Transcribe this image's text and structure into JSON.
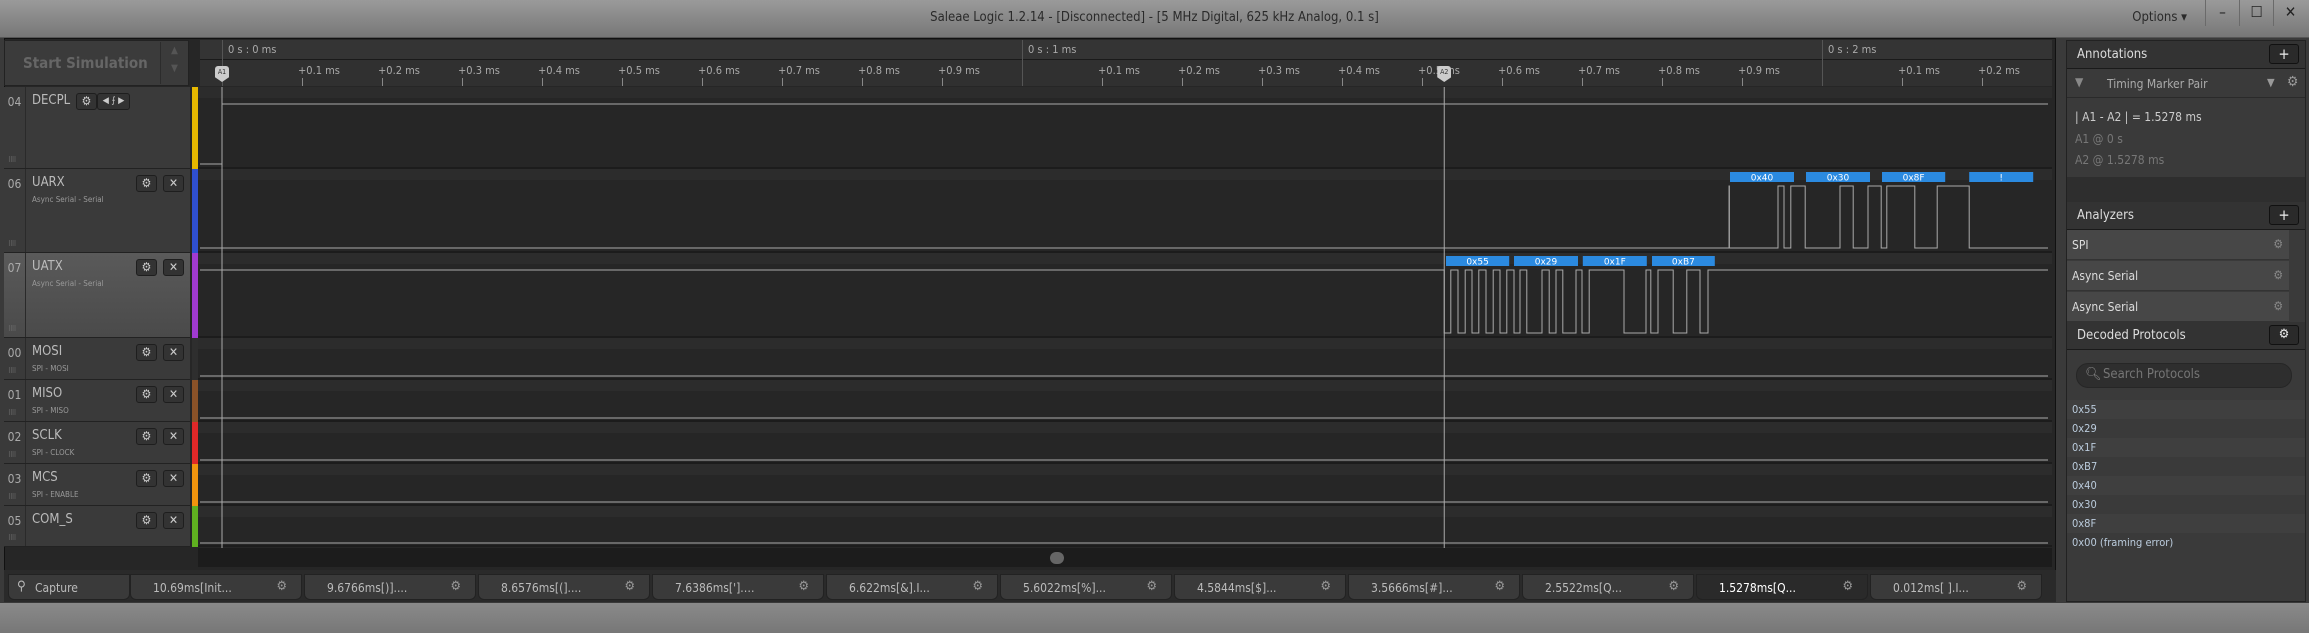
{
  "window": {
    "title": "Saleae Logic 1.2.14 - [Disconnected] - [5 MHz Digital, 625 kHz Analog, 0.1 s]",
    "options_label": "Options ▾",
    "minimize": "–",
    "maximize": "☐",
    "close": "✕"
  },
  "sim": {
    "label": "Start Simulation"
  },
  "timeline": {
    "major": [
      {
        "t": 0,
        "label": "0 s : 0 ms"
      },
      {
        "t": 1,
        "label": "0 s : 1 ms"
      },
      {
        "t": 2,
        "label": "0 s : 2 ms"
      }
    ],
    "minor_labels": [
      "+0.1 ms",
      "+0.2 ms",
      "+0.3 ms",
      "+0.4 ms",
      "+0.5 ms",
      "+0.6 ms",
      "+0.7 ms",
      "+0.8 ms",
      "+0.9 ms"
    ],
    "view_ms": [
      -0.0275,
      2.2825
    ],
    "markers": [
      {
        "label": "A1",
        "t": 0
      },
      {
        "label": "A2",
        "t": 1.5278
      }
    ]
  },
  "channels": [
    {
      "num": "04",
      "name": "DECPL",
      "sub": "",
      "color": "#e6b800",
      "init": 0,
      "toggles": [
        0
      ],
      "labels": []
    },
    {
      "num": "06",
      "name": "UARX",
      "sub": "Async Serial - Serial",
      "color": "#2f4fd0",
      "init": 0,
      "toggles": [
        1.8838,
        1.8842,
        1.945,
        1.9525,
        1.961,
        1.979,
        2.0225,
        2.039,
        2.0575,
        2.074,
        2.081,
        2.116,
        2.144,
        2.184
      ],
      "labels": [
        {
          "text": "0x40",
          "t0": 1.885,
          "t1": 1.965
        },
        {
          "text": "0x30",
          "t0": 1.98,
          "t1": 2.06
        },
        {
          "text": "0x8F",
          "t0": 2.075,
          "t1": 2.154
        },
        {
          "text": "!",
          "t0": 2.184,
          "t1": 2.264
        }
      ]
    },
    {
      "num": "07",
      "name": "UATX",
      "sub": "Async Serial - Serial",
      "color": "#a03ad0",
      "init": 1,
      "toggles": [
        1.5278,
        1.536,
        1.545,
        1.554,
        1.5625,
        1.571,
        1.58,
        1.589,
        1.5975,
        1.606,
        1.615,
        1.6225,
        1.631,
        1.65,
        1.659,
        1.6675,
        1.676,
        1.6925,
        1.7,
        1.709,
        1.7525,
        1.78,
        1.786,
        1.795,
        1.814,
        1.831,
        1.8475,
        1.8575
      ],
      "labels": [
        {
          "text": "0x55",
          "t0": 1.53,
          "t1": 1.609
        },
        {
          "text": "0x29",
          "t0": 1.615,
          "t1": 1.695
        },
        {
          "text": "0x1F",
          "t0": 1.701,
          "t1": 1.781
        },
        {
          "text": "0xB7",
          "t0": 1.7875,
          "t1": 1.866
        }
      ]
    },
    {
      "num": "00",
      "name": "MOSI",
      "sub": "SPI - MOSI",
      "color": "#2e2e2e",
      "init": 0,
      "toggles": [],
      "labels": []
    },
    {
      "num": "01",
      "name": "MISO",
      "sub": "SPI - MISO",
      "color": "#8a5228",
      "init": 0,
      "toggles": [],
      "labels": []
    },
    {
      "num": "02",
      "name": "SCLK",
      "sub": "SPI - CLOCK",
      "color": "#e02828",
      "init": 0,
      "toggles": [],
      "labels": []
    },
    {
      "num": "03",
      "name": "MCS",
      "sub": "SPI - ENABLE",
      "color": "#f0940e",
      "init": 0,
      "toggles": [],
      "labels": []
    },
    {
      "num": "05",
      "name": "COM_S",
      "sub": "",
      "color": "#5fb020",
      "init": 0,
      "toggles": [],
      "labels": []
    }
  ],
  "label_color": "#2b8ae0",
  "tabs": {
    "capture": "Capture",
    "items": [
      "10.69ms[Init...",
      "9.6766ms[)]....",
      "8.6576ms[(]....",
      "7.6386ms['].…",
      "6.622ms[&].I...",
      "5.6022ms[%]...",
      "4.5844ms[$]...",
      "3.5666ms[#]...",
      "2.5522ms[Q...",
      "1.5278ms[Q...",
      "0.012ms[ ].I..."
    ],
    "active": 9
  },
  "annotations": {
    "title": "Annotations",
    "add": "+",
    "type": "Timing Marker Pair",
    "measure": "| A1 - A2 | = 1.5278 ms",
    "a1": "A1  @  0 s",
    "a2": "A2  @  1.5278 ms"
  },
  "analyzers": {
    "title": "Analyzers",
    "add": "+",
    "items": [
      "SPI",
      "Async Serial",
      "Async Serial"
    ]
  },
  "decoded": {
    "title": "Decoded Protocols",
    "search_placeholder": "Search Protocols",
    "items": [
      "0x55",
      "0x29",
      "0x1F",
      "0xB7",
      "0x40",
      "0x30",
      "0x8F",
      "0x00 (framing error)"
    ]
  }
}
